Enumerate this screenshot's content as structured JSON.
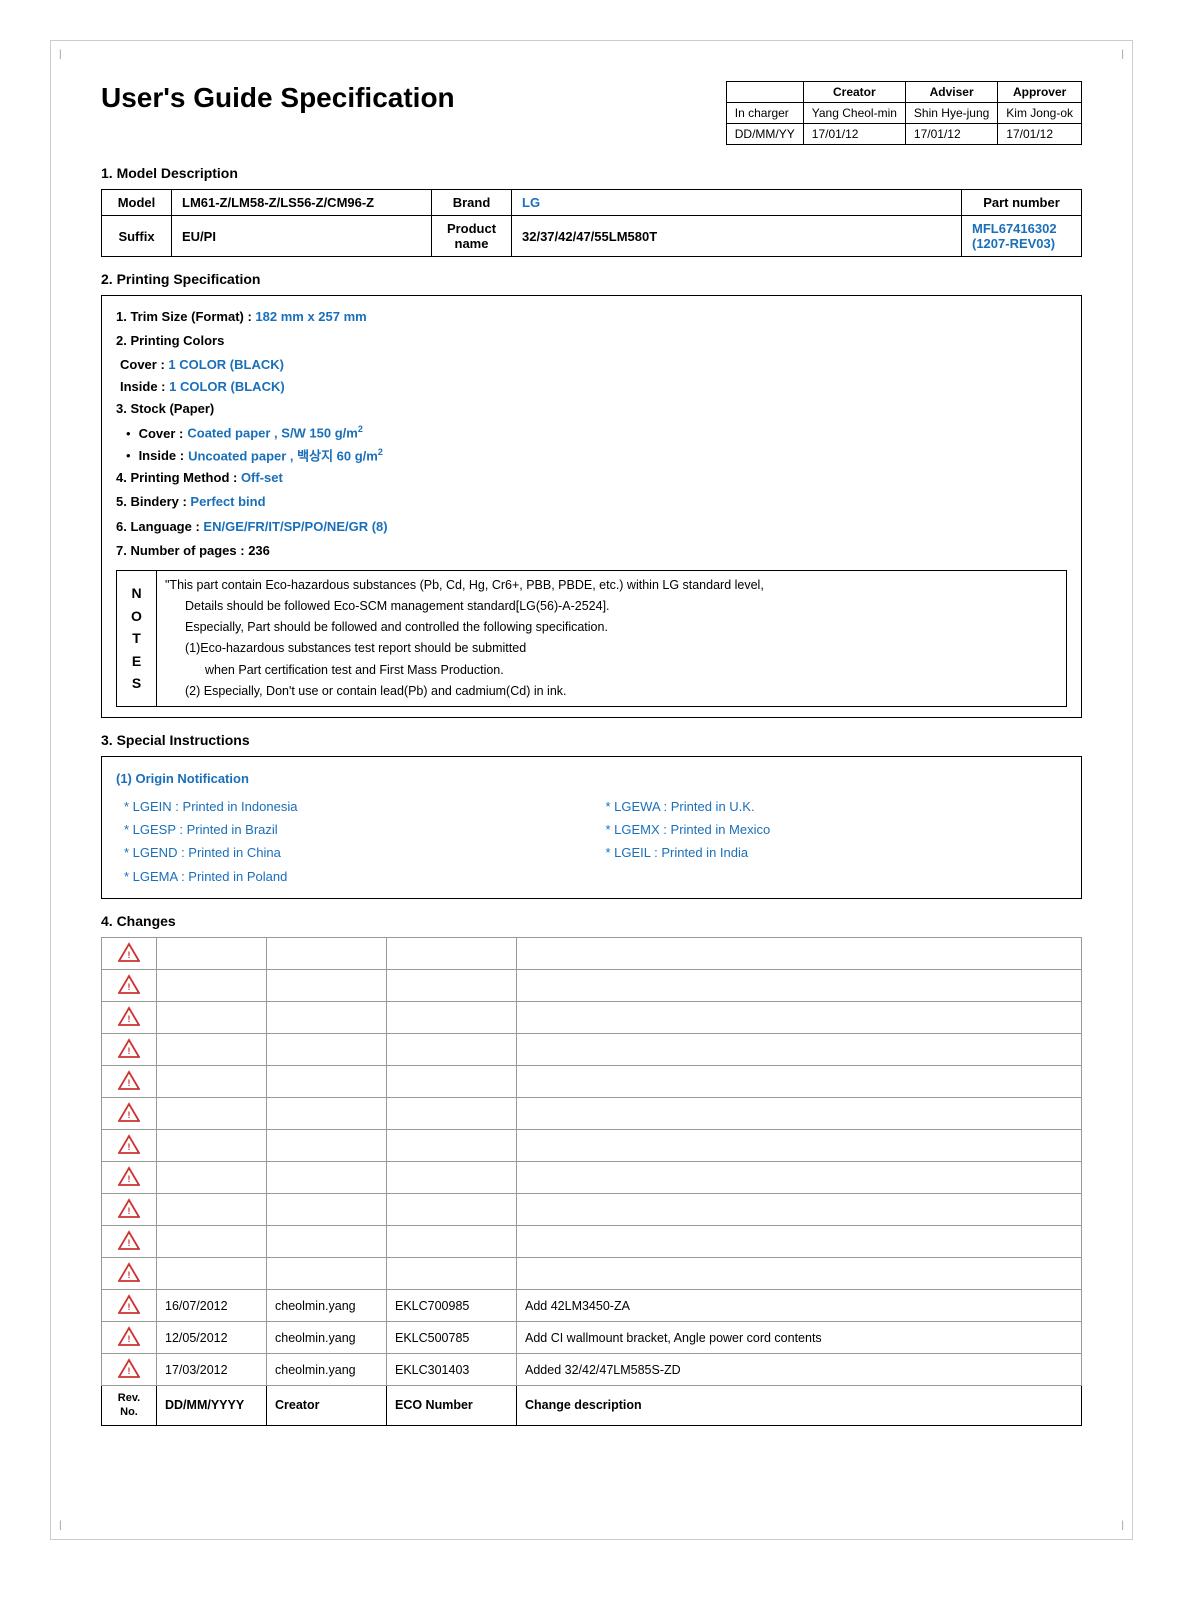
{
  "page": {
    "title": "User's Guide Specification",
    "border_color": "#cccccc"
  },
  "header_table": {
    "cols": [
      "",
      "Creator",
      "Adviser",
      "Approver"
    ],
    "rows": [
      [
        "In charger",
        "Yang Cheol-min",
        "Shin Hye-jung",
        "Kim Jong-ok"
      ],
      [
        "DD/MM/YY",
        "17/01/12",
        "17/01/12",
        "17/01/12"
      ]
    ]
  },
  "section1": {
    "heading": "1. Model Description",
    "model_label": "Model",
    "model_value": "LM61-Z/LM58-Z/LS56-Z/CM96-Z",
    "brand_label": "Brand",
    "brand_value": "LG",
    "part_label": "Part number",
    "part_value": "MFL67416302\n(1207-REV03)",
    "suffix_label": "Suffix",
    "suffix_value": "EU/PI",
    "product_label": "Product name",
    "product_value": "32/37/42/47/55LM580T"
  },
  "section2": {
    "heading": "2. Printing Specification",
    "trim_size_label": "1. Trim Size (Format) :",
    "trim_size_value": "182 mm x 257 mm",
    "colors_label": "2. Printing Colors",
    "cover_label": "Cover :",
    "cover_value": "1 COLOR (BLACK)",
    "inside_label": "Inside :",
    "inside_value": "1 COLOR (BLACK)",
    "stock_label": "3. Stock (Paper)",
    "stock_cover_label": "Cover :",
    "stock_cover_value": "Coated paper , S/W 150 g/m²",
    "stock_inside_label": "Inside :",
    "stock_inside_value": "Uncoated paper , 백상지 60 g/m²",
    "method_label": "4. Printing Method :",
    "method_value": "Off-set",
    "bindery_label": "5. Bindery  :",
    "bindery_value": "Perfect bind",
    "language_label": "6. Language :",
    "language_value": "EN/GE/FR/IT/SP/PO/NE/GR (8)",
    "pages_label": "7. Number of pages :",
    "pages_value": "236",
    "notes": {
      "label_lines": [
        "N",
        "O",
        "T",
        "E",
        "S"
      ],
      "lines": [
        "\"This part contain Eco-hazardous substances (Pb, Cd, Hg, Cr6+, PBB, PBDE, etc.) within LG standard level,",
        "Details should be followed Eco-SCM management standard[LG(56)-A-2524].",
        "Especially, Part should be followed and controlled the following specification.",
        "(1)Eco-hazardous substances test report should be submitted",
        "when  Part certification test and First Mass Production.",
        "(2) Especially, Don't use or contain lead(Pb) and cadmium(Cd) in ink."
      ]
    }
  },
  "section3": {
    "heading": "3. Special Instructions",
    "origin_heading": "(1) Origin Notification",
    "origins": [
      "* LGEIN : Printed in Indonesia",
      "* LGESP : Printed in Brazil",
      "* LGEND : Printed in China",
      "* LGEMA : Printed in Poland",
      "* LGEWA : Printed in U.K.",
      "* LGEMX : Printed in Mexico",
      "* LGEIL : Printed in India"
    ]
  },
  "section4": {
    "heading": "4. Changes",
    "columns": [
      "Rev. No.",
      "DD/MM/YYYY",
      "Creator",
      "ECO Number",
      "Change description"
    ],
    "empty_rows": 11,
    "data_rows": [
      {
        "date": "16/07/2012",
        "creator": "cheolmin.yang",
        "eco": "EKLC700985",
        "desc": "Add 42LM3450-ZA"
      },
      {
        "date": "12/05/2012",
        "creator": "cheolmin.yang",
        "eco": "EKLC500785",
        "desc": "Add CI wallmount bracket, Angle power cord contents"
      },
      {
        "date": "17/03/2012",
        "creator": "cheolmin.yang",
        "eco": "EKLC301403",
        "desc": "Added 32/42/47LM585S-ZD"
      }
    ],
    "header_row": {
      "rev": "Rev.\nNo.",
      "date": "DD/MM/YYYY",
      "creator": "Creator",
      "eco": "ECO Number",
      "desc": "Change description"
    }
  },
  "colors": {
    "blue": "#1a6fba",
    "red_border": "#cc3333",
    "table_border": "#000000"
  }
}
